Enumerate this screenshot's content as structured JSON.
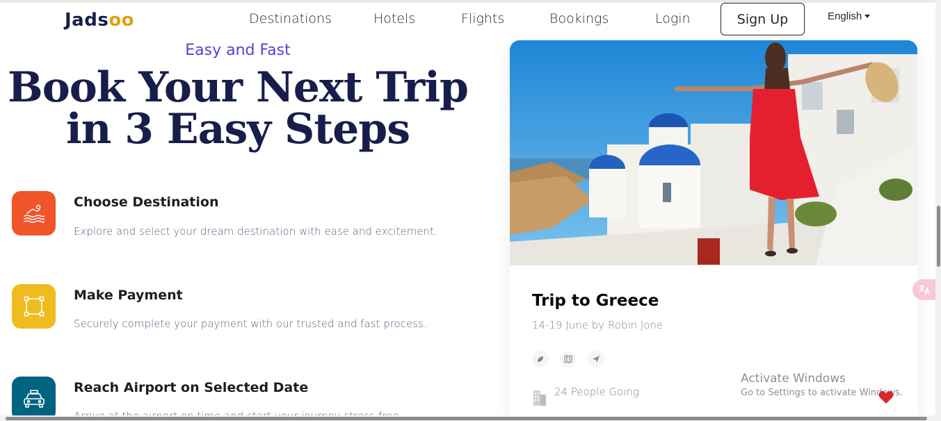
{
  "header": {
    "logo_main": "Jads",
    "logo_accent": "oo",
    "nav": [
      "Destinations",
      "Hotels",
      "Flights",
      "Bookings",
      "Login"
    ],
    "signup_label": "Sign Up",
    "language": "English"
  },
  "hero": {
    "subtitle": "Easy and Fast",
    "headline_line1": "Book Your Next Trip",
    "headline_line2": "in 3 Easy Steps"
  },
  "steps": [
    {
      "title": "Choose Destination",
      "desc": "Explore and select your dream destination with ease and excitement.",
      "icon": "destination-icon",
      "color": "#f0552a"
    },
    {
      "title": "Make Payment",
      "desc": "Securely complete your payment with our trusted and fast process.",
      "icon": "payment-icon",
      "color": "#f0bb1f"
    },
    {
      "title": "Reach Airport on Selected Date",
      "desc": "Arrive at the airport on time and start your journey stress-free.",
      "icon": "taxi-icon",
      "color": "#006380"
    }
  ],
  "trip_card": {
    "title": "Trip to Greece",
    "subtitle": "14-19 June by Robin Jone",
    "icons": [
      "leaf-icon",
      "map-icon",
      "send-icon"
    ],
    "people": "24 People Going"
  },
  "windows_watermark": {
    "line1": "Activate Windows",
    "line2": "Go to Settings to activate Windows."
  },
  "colors": {
    "accent_purple": "#5a3fd8",
    "logo_yellow": "#dfa016",
    "navy": "#181e4b"
  }
}
